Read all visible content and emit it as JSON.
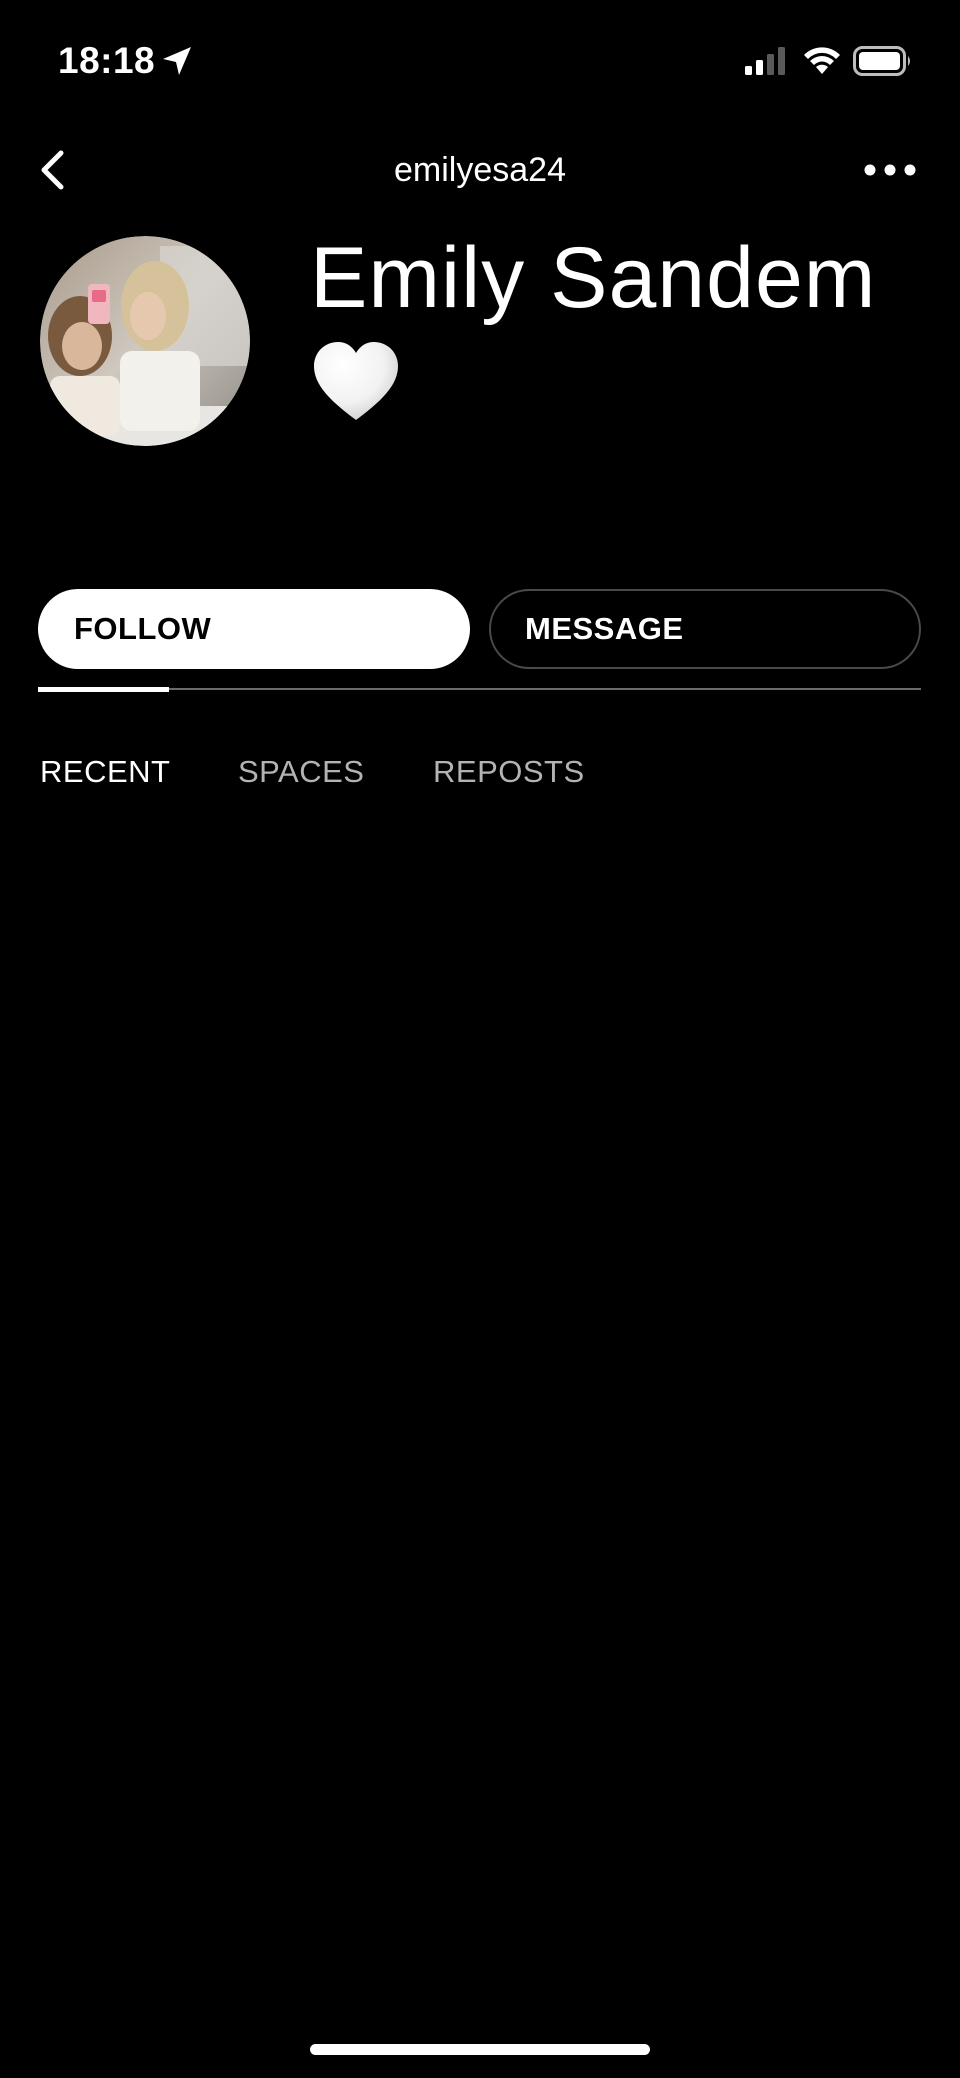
{
  "status_bar": {
    "time": "18:18",
    "icons": [
      "location-arrow-icon",
      "cellular-signal-icon",
      "wifi-icon",
      "battery-icon"
    ]
  },
  "nav": {
    "title": "emilyesa24",
    "back_icon": "chevron-left-icon",
    "more_icon": "ellipsis-icon"
  },
  "profile": {
    "display_name": "Emily Sandem",
    "emoji_icon": "white-heart-icon"
  },
  "actions": {
    "follow_label": "FOLLOW",
    "message_label": "MESSAGE"
  },
  "tabs": [
    {
      "label": "RECENT",
      "active": true
    },
    {
      "label": "SPACES",
      "active": false
    },
    {
      "label": "REPOSTS",
      "active": false
    }
  ],
  "colors": {
    "background": "#000000",
    "text_primary": "#ffffff",
    "text_secondary": "#b3b3b3",
    "outline": "#4a4a4a"
  }
}
